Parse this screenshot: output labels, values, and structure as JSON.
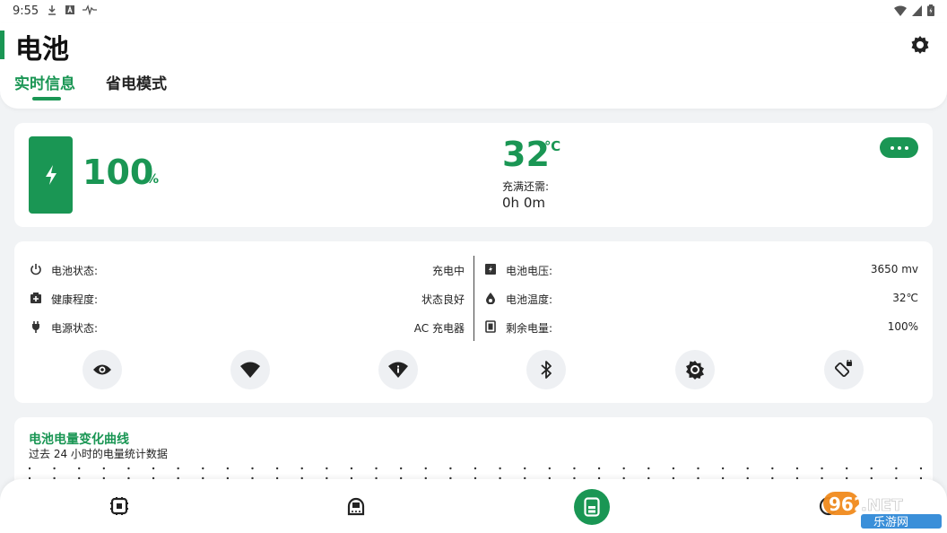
{
  "status_bar": {
    "time": "9:55",
    "left_icons": [
      "download-icon",
      "a-letter-icon",
      "pulse-icon"
    ],
    "right_icons": [
      "wifi-icon",
      "signal-icon",
      "battery-icon"
    ]
  },
  "header": {
    "title": "电池",
    "tabs": [
      {
        "label": "实时信息",
        "active": true
      },
      {
        "label": "省电模式",
        "active": false
      }
    ]
  },
  "summary": {
    "battery_level": "100",
    "battery_unit": "%",
    "temperature": "32",
    "temperature_unit": "℃",
    "charge_remaining_label": "充满还需:",
    "charge_remaining_value": "0h 0m"
  },
  "info": {
    "left": [
      {
        "icon": "power-icon",
        "label": "电池状态:",
        "value": "充电中"
      },
      {
        "icon": "health-icon",
        "label": "健康程度:",
        "value": "状态良好"
      },
      {
        "icon": "plug-icon",
        "label": "电源状态:",
        "value": "AC 充电器"
      }
    ],
    "right": [
      {
        "icon": "voltage-icon",
        "label": "电池电压:",
        "value": "3650 mv"
      },
      {
        "icon": "temperature-drop-icon",
        "label": "电池温度:",
        "value": "32℃"
      },
      {
        "icon": "battery-remaining-icon",
        "label": "剩余电量:",
        "value": "100%"
      }
    ],
    "toggles": [
      "eye-icon",
      "wifi-icon",
      "wifi-info-icon",
      "bluetooth-icon",
      "brightness-icon",
      "auto-rotate-icon"
    ]
  },
  "curve": {
    "title": "电池电量变化曲线",
    "subtitle": "过去 24 小时的电量统计数据"
  },
  "bottom_nav": {
    "items": [
      "chip-icon",
      "storage-icon",
      "battery-nav-icon",
      "more-nav-icon"
    ],
    "active_index": 2
  },
  "watermark": {
    "brand": "962.NET",
    "brand_sub": "乐游网"
  },
  "colors": {
    "accent": "#1a9654",
    "background": "#f1f3f5",
    "card": "#ffffff",
    "toggle_bg": "#eef0f3"
  }
}
